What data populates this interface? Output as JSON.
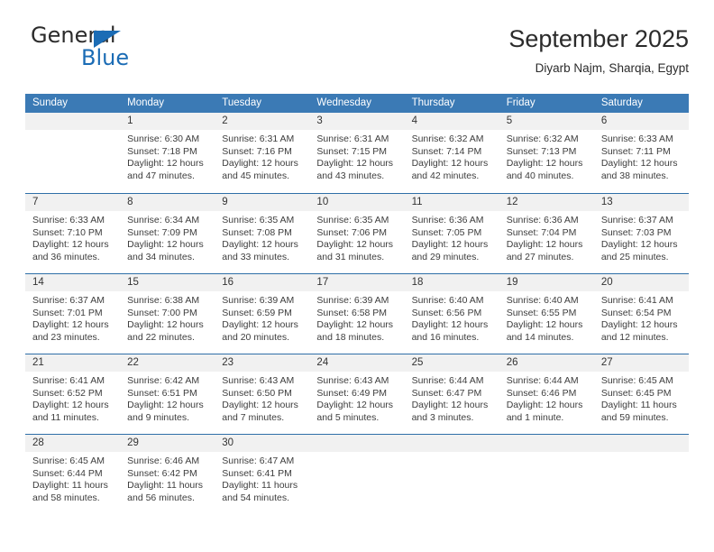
{
  "brand": {
    "name_top": "General",
    "name_bottom": "Blue",
    "accent_color": "#1b6cb5"
  },
  "header": {
    "title": "September 2025",
    "subtitle": "Diyarb Najm, Sharqia, Egypt"
  },
  "theme": {
    "header_blue": "#3b7ab5",
    "rule_blue": "#2f6fa8",
    "date_band_gray": "#f1f1f1",
    "text_color": "#333333"
  },
  "calendar": {
    "weekdays": [
      "Sunday",
      "Monday",
      "Tuesday",
      "Wednesday",
      "Thursday",
      "Friday",
      "Saturday"
    ],
    "weeks": [
      [
        {
          "date": "",
          "lines": []
        },
        {
          "date": "1",
          "lines": [
            "Sunrise: 6:30 AM",
            "Sunset: 7:18 PM",
            "Daylight: 12 hours",
            "and 47 minutes."
          ]
        },
        {
          "date": "2",
          "lines": [
            "Sunrise: 6:31 AM",
            "Sunset: 7:16 PM",
            "Daylight: 12 hours",
            "and 45 minutes."
          ]
        },
        {
          "date": "3",
          "lines": [
            "Sunrise: 6:31 AM",
            "Sunset: 7:15 PM",
            "Daylight: 12 hours",
            "and 43 minutes."
          ]
        },
        {
          "date": "4",
          "lines": [
            "Sunrise: 6:32 AM",
            "Sunset: 7:14 PM",
            "Daylight: 12 hours",
            "and 42 minutes."
          ]
        },
        {
          "date": "5",
          "lines": [
            "Sunrise: 6:32 AM",
            "Sunset: 7:13 PM",
            "Daylight: 12 hours",
            "and 40 minutes."
          ]
        },
        {
          "date": "6",
          "lines": [
            "Sunrise: 6:33 AM",
            "Sunset: 7:11 PM",
            "Daylight: 12 hours",
            "and 38 minutes."
          ]
        }
      ],
      [
        {
          "date": "7",
          "lines": [
            "Sunrise: 6:33 AM",
            "Sunset: 7:10 PM",
            "Daylight: 12 hours",
            "and 36 minutes."
          ]
        },
        {
          "date": "8",
          "lines": [
            "Sunrise: 6:34 AM",
            "Sunset: 7:09 PM",
            "Daylight: 12 hours",
            "and 34 minutes."
          ]
        },
        {
          "date": "9",
          "lines": [
            "Sunrise: 6:35 AM",
            "Sunset: 7:08 PM",
            "Daylight: 12 hours",
            "and 33 minutes."
          ]
        },
        {
          "date": "10",
          "lines": [
            "Sunrise: 6:35 AM",
            "Sunset: 7:06 PM",
            "Daylight: 12 hours",
            "and 31 minutes."
          ]
        },
        {
          "date": "11",
          "lines": [
            "Sunrise: 6:36 AM",
            "Sunset: 7:05 PM",
            "Daylight: 12 hours",
            "and 29 minutes."
          ]
        },
        {
          "date": "12",
          "lines": [
            "Sunrise: 6:36 AM",
            "Sunset: 7:04 PM",
            "Daylight: 12 hours",
            "and 27 minutes."
          ]
        },
        {
          "date": "13",
          "lines": [
            "Sunrise: 6:37 AM",
            "Sunset: 7:03 PM",
            "Daylight: 12 hours",
            "and 25 minutes."
          ]
        }
      ],
      [
        {
          "date": "14",
          "lines": [
            "Sunrise: 6:37 AM",
            "Sunset: 7:01 PM",
            "Daylight: 12 hours",
            "and 23 minutes."
          ]
        },
        {
          "date": "15",
          "lines": [
            "Sunrise: 6:38 AM",
            "Sunset: 7:00 PM",
            "Daylight: 12 hours",
            "and 22 minutes."
          ]
        },
        {
          "date": "16",
          "lines": [
            "Sunrise: 6:39 AM",
            "Sunset: 6:59 PM",
            "Daylight: 12 hours",
            "and 20 minutes."
          ]
        },
        {
          "date": "17",
          "lines": [
            "Sunrise: 6:39 AM",
            "Sunset: 6:58 PM",
            "Daylight: 12 hours",
            "and 18 minutes."
          ]
        },
        {
          "date": "18",
          "lines": [
            "Sunrise: 6:40 AM",
            "Sunset: 6:56 PM",
            "Daylight: 12 hours",
            "and 16 minutes."
          ]
        },
        {
          "date": "19",
          "lines": [
            "Sunrise: 6:40 AM",
            "Sunset: 6:55 PM",
            "Daylight: 12 hours",
            "and 14 minutes."
          ]
        },
        {
          "date": "20",
          "lines": [
            "Sunrise: 6:41 AM",
            "Sunset: 6:54 PM",
            "Daylight: 12 hours",
            "and 12 minutes."
          ]
        }
      ],
      [
        {
          "date": "21",
          "lines": [
            "Sunrise: 6:41 AM",
            "Sunset: 6:52 PM",
            "Daylight: 12 hours",
            "and 11 minutes."
          ]
        },
        {
          "date": "22",
          "lines": [
            "Sunrise: 6:42 AM",
            "Sunset: 6:51 PM",
            "Daylight: 12 hours",
            "and 9 minutes."
          ]
        },
        {
          "date": "23",
          "lines": [
            "Sunrise: 6:43 AM",
            "Sunset: 6:50 PM",
            "Daylight: 12 hours",
            "and 7 minutes."
          ]
        },
        {
          "date": "24",
          "lines": [
            "Sunrise: 6:43 AM",
            "Sunset: 6:49 PM",
            "Daylight: 12 hours",
            "and 5 minutes."
          ]
        },
        {
          "date": "25",
          "lines": [
            "Sunrise: 6:44 AM",
            "Sunset: 6:47 PM",
            "Daylight: 12 hours",
            "and 3 minutes."
          ]
        },
        {
          "date": "26",
          "lines": [
            "Sunrise: 6:44 AM",
            "Sunset: 6:46 PM",
            "Daylight: 12 hours",
            "and 1 minute."
          ]
        },
        {
          "date": "27",
          "lines": [
            "Sunrise: 6:45 AM",
            "Sunset: 6:45 PM",
            "Daylight: 11 hours",
            "and 59 minutes."
          ]
        }
      ],
      [
        {
          "date": "28",
          "lines": [
            "Sunrise: 6:45 AM",
            "Sunset: 6:44 PM",
            "Daylight: 11 hours",
            "and 58 minutes."
          ]
        },
        {
          "date": "29",
          "lines": [
            "Sunrise: 6:46 AM",
            "Sunset: 6:42 PM",
            "Daylight: 11 hours",
            "and 56 minutes."
          ]
        },
        {
          "date": "30",
          "lines": [
            "Sunrise: 6:47 AM",
            "Sunset: 6:41 PM",
            "Daylight: 11 hours",
            "and 54 minutes."
          ]
        },
        {
          "date": "",
          "lines": []
        },
        {
          "date": "",
          "lines": []
        },
        {
          "date": "",
          "lines": []
        },
        {
          "date": "",
          "lines": []
        }
      ]
    ]
  }
}
